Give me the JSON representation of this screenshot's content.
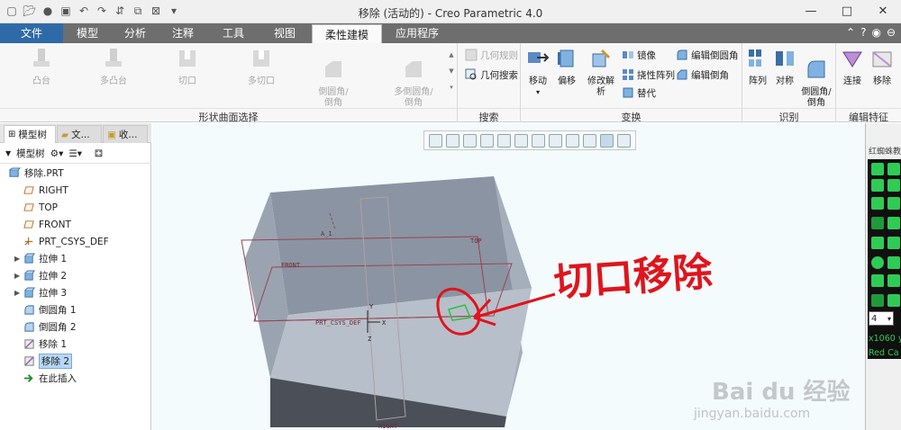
{
  "window": {
    "title": "移除 (活动的) - Creo Parametric 4.0",
    "window_controls": [
      "—",
      "□",
      "✕"
    ]
  },
  "tabs": [
    {
      "label": "文件",
      "style": "file"
    },
    {
      "label": "模型"
    },
    {
      "label": "分析"
    },
    {
      "label": "注释"
    },
    {
      "label": "工具"
    },
    {
      "label": "视图"
    },
    {
      "label": "柔性建模",
      "active": true
    },
    {
      "label": "应用程序"
    }
  ],
  "ribbon": {
    "shape_group": {
      "label": "形状曲面选择",
      "buttons": [
        "凸台",
        "多凸台",
        "切口",
        "多切口",
        "倒圆角/\n倒角",
        "多倒圆角/\n倒角"
      ]
    },
    "search_group": {
      "label": "搜索",
      "items": [
        "几何规则",
        "几何搜索"
      ]
    },
    "transform_group": {
      "label": "变换",
      "big": [
        "移动",
        "偏移",
        "修改解析"
      ],
      "small": [
        "镜像",
        "挠性阵列",
        "替代",
        "编辑倒圆角",
        "编辑倒角"
      ]
    },
    "identify_group": {
      "label": "识别",
      "big": [
        "阵列",
        "对称",
        "倒圆角/\n倒角"
      ]
    },
    "edit_group": {
      "label": "编辑特征",
      "big": [
        "连接",
        "移除"
      ]
    }
  },
  "panel": {
    "tabs": [
      "模型树",
      "文...",
      "收..."
    ],
    "toolbar_label": "模型树",
    "tree": [
      {
        "label": "移除.PRT",
        "icon": "part-icon",
        "level": 0
      },
      {
        "label": "RIGHT",
        "icon": "datum-plane-icon",
        "level": 1
      },
      {
        "label": "TOP",
        "icon": "datum-plane-icon",
        "level": 1
      },
      {
        "label": "FRONT",
        "icon": "datum-plane-icon",
        "level": 1
      },
      {
        "label": "PRT_CSYS_DEF",
        "icon": "csys-icon",
        "level": 1
      },
      {
        "label": "拉伸 1",
        "icon": "extrude-icon",
        "level": 1,
        "expandable": true
      },
      {
        "label": "拉伸 2",
        "icon": "extrude-icon",
        "level": 1,
        "expandable": true
      },
      {
        "label": "拉伸 3",
        "icon": "extrude-icon",
        "level": 1,
        "expandable": true
      },
      {
        "label": "倒圆角 1",
        "icon": "round-icon",
        "level": 1
      },
      {
        "label": "倒圆角 2",
        "icon": "round-icon",
        "level": 1
      },
      {
        "label": "移除 1",
        "icon": "remove-icon",
        "level": 1
      },
      {
        "label": "移除 2",
        "icon": "remove-icon",
        "level": 1,
        "selected": true
      },
      {
        "label": "在此插入",
        "icon": "insert-here-icon",
        "level": 1
      }
    ]
  },
  "viewport": {
    "datum_labels": {
      "top": "TOP",
      "front": "FRONT",
      "csys": "PRT_CSYS_DEF",
      "axis_y": "Y",
      "axis_x": "X",
      "axis_z": "Z",
      "a1": "A_1",
      "bottom": "RIGHT"
    },
    "annotation": "切口移除"
  },
  "right_panel": {
    "title": "红蜘蛛教师",
    "select_value": "4",
    "coords": [
      "x1060 y",
      "Red Ca"
    ]
  },
  "watermark": {
    "text": "Bai du 经验",
    "url": "jingyan.baidu.com"
  },
  "colors": {
    "file_tab": "#2f6aa8",
    "tabstrip": "#6e6e6e",
    "annotation": "#e0141c",
    "part": "#8e97a4",
    "selection": "#b6d7f5"
  }
}
